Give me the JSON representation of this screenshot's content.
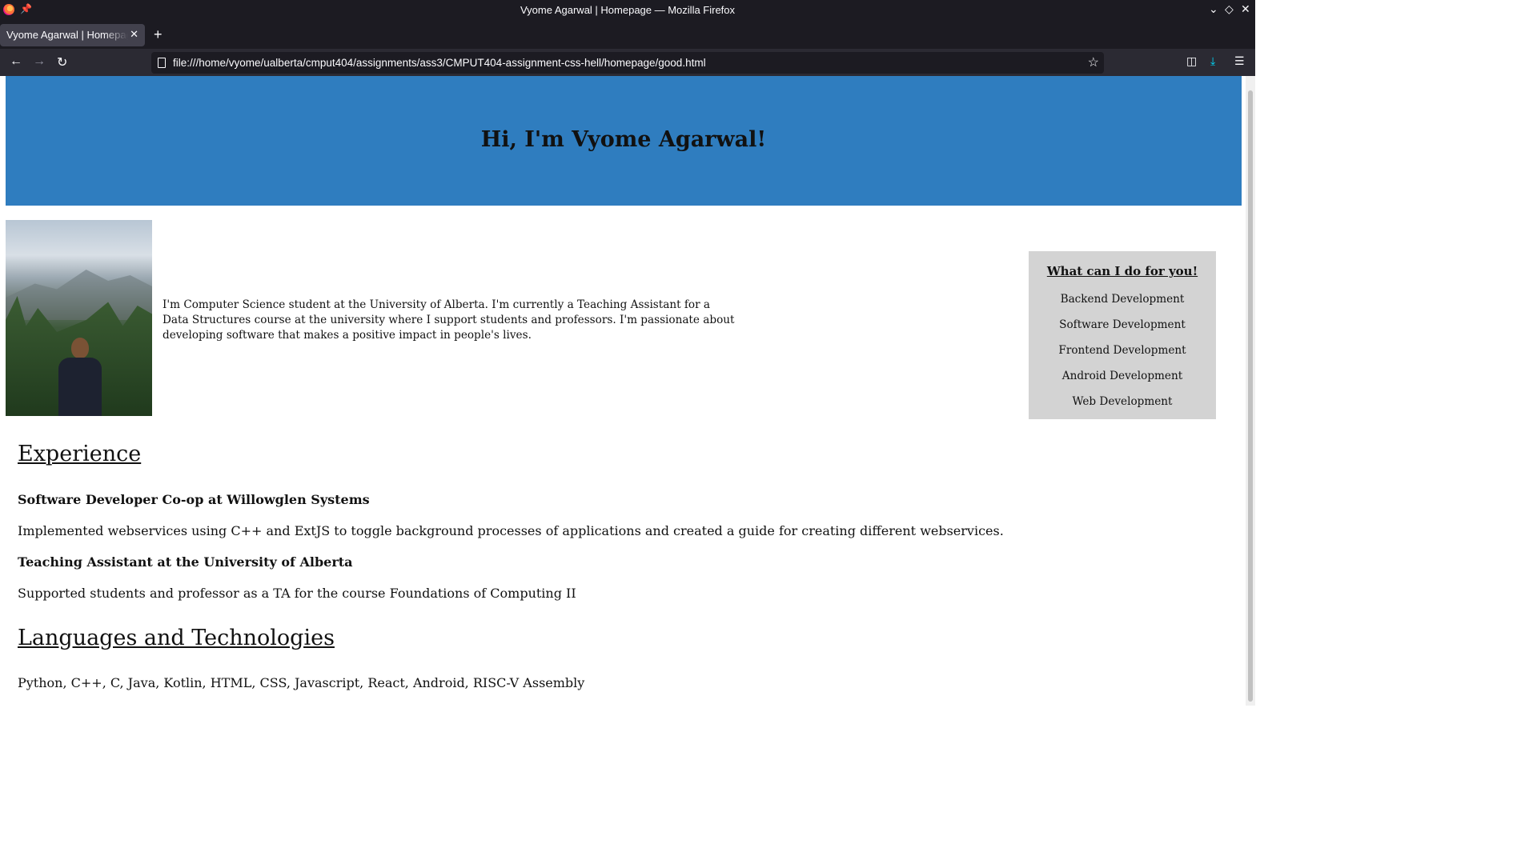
{
  "browser": {
    "window_title": "Vyome Agarwal | Homepage — Mozilla Firefox",
    "tab_title": "Vyome Agarwal | Homepage",
    "url": "file:///home/vyome/ualberta/cmput404/assignments/ass3/CMPUT404-assignment-css-hell/homepage/good.html"
  },
  "page": {
    "hero_title": "Hi, I'm Vyome Agarwal!",
    "intro": "I'm Computer Science student at the University of Alberta. I'm currently a Teaching Assistant for a Data Structures course at the university where I support students and professors. I'm passionate about developing software that makes a positive impact in people's lives.",
    "services": {
      "title": "What can I do for you!",
      "items": [
        "Backend Development",
        "Software Development",
        "Frontend Development",
        "Android Development",
        "Web Development"
      ]
    },
    "experience": {
      "heading": "Experience",
      "jobs": [
        {
          "title": "Software Developer Co-op at Willowglen Systems",
          "description": "Implemented webservices using C++ and ExtJS to toggle background processes of applications and created a guide for creating different webservices."
        },
        {
          "title": "Teaching Assistant at the University of Alberta",
          "description": "Supported students and professor as a TA for the course Foundations of Computing II"
        }
      ]
    },
    "languages": {
      "heading": "Languages and Technologies",
      "list": "Python, C++, C, Java, Kotlin, HTML, CSS, Javascript, React, Android, RISC-V Assembly"
    }
  },
  "colors": {
    "hero_background": "#2f7dbf",
    "services_background": "#d3d3d3",
    "browser_chrome": "#1c1b22"
  }
}
